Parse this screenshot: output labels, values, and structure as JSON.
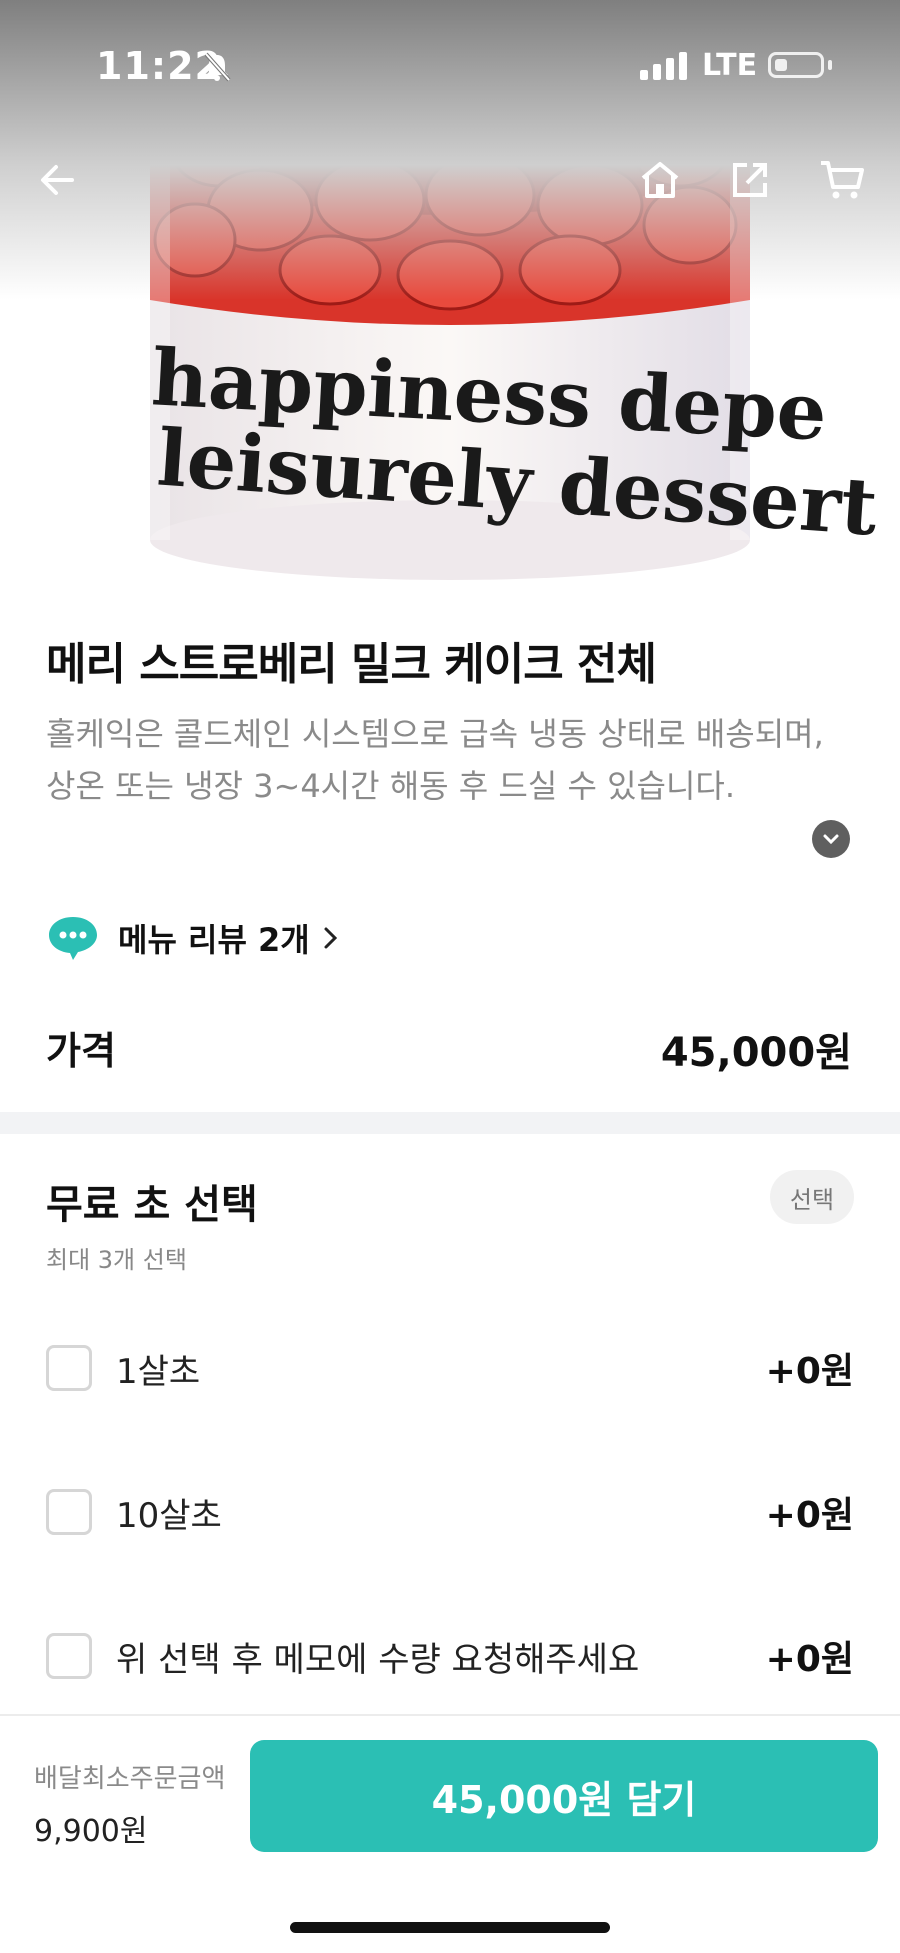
{
  "status_bar": {
    "time": "11:22",
    "network": "LTE"
  },
  "hero": {
    "image_text_line1": "happiness depe",
    "image_text_line2": "leisurely dessert",
    "icons": [
      "back-arrow-icon",
      "home-icon",
      "share-icon",
      "cart-icon"
    ]
  },
  "product": {
    "title": "메리 스트로베리 밀크 케이크 전체",
    "description": "홀케익은 콜드체인 시스템으로 급속 냉동 상태로 배송되며, 상온 또는 냉장 3~4시간 해동 후 드실 수 있습니다.",
    "review_label": "메뉴 리뷰 2개",
    "price_label": "가격",
    "price_value": "45,000원"
  },
  "options": {
    "title": "무료 초 선택",
    "badge": "선택",
    "subtitle": "최대 3개 선택",
    "items": [
      {
        "label": "1살초",
        "price": "+0원"
      },
      {
        "label": "10살초",
        "price": "+0원"
      },
      {
        "label": "위 선택 후 메모에 수량 요청해주세요",
        "price": "+0원"
      }
    ]
  },
  "footer": {
    "min_order_label": "배달최소주문금액",
    "min_order_value": "9,900원",
    "add_button": "45,000원 담기"
  },
  "colors": {
    "accent": "#2bbfb4",
    "strawberry": "#d12a22",
    "cream": "#f6efe9"
  }
}
